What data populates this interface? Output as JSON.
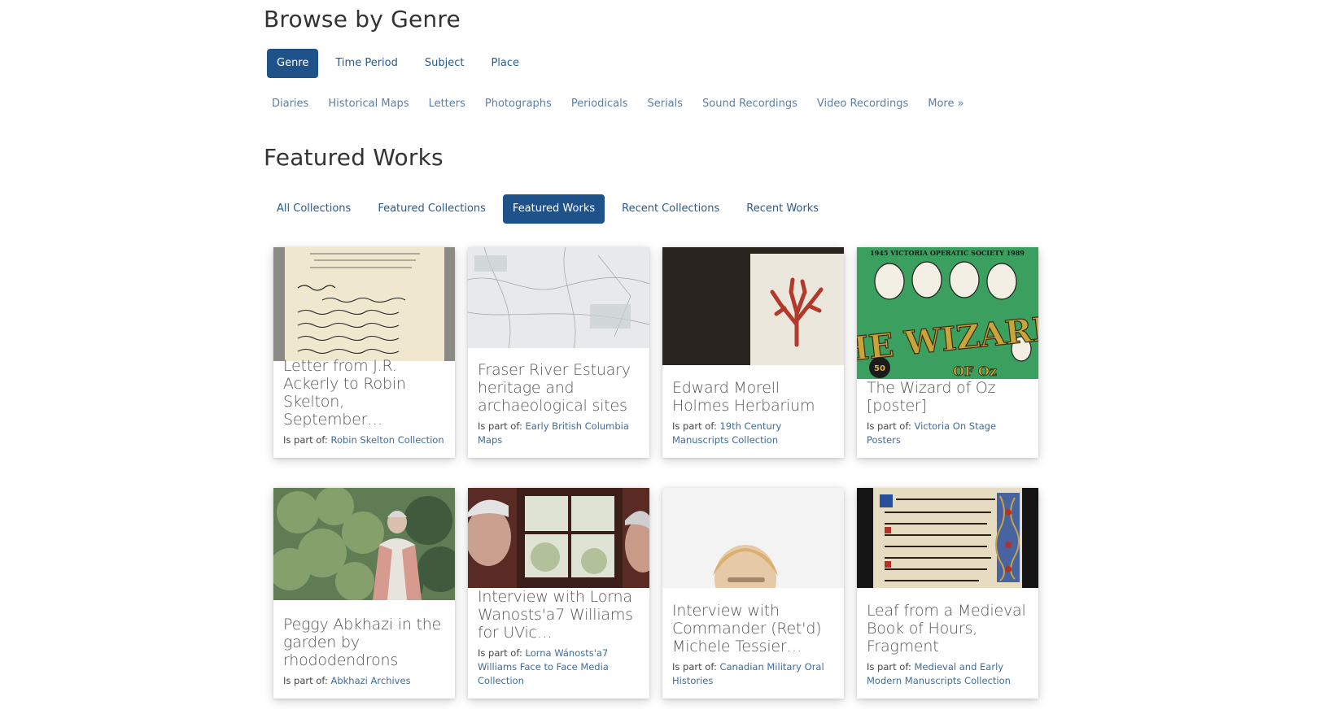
{
  "browse": {
    "title": "Browse by Genre",
    "tabs": [
      "Genre",
      "Time Period",
      "Subject",
      "Place"
    ],
    "active_tab": "Genre",
    "genre_links": [
      "Diaries",
      "Historical Maps",
      "Letters",
      "Photographs",
      "Periodicals",
      "Serials",
      "Sound Recordings",
      "Video Recordings",
      "More »"
    ]
  },
  "featured": {
    "title": "Featured Works",
    "tabs": [
      "All Collections",
      "Featured Collections",
      "Featured Works",
      "Recent Collections",
      "Recent Works"
    ],
    "active_tab": "Featured Works",
    "part_of_label": "Is part of:",
    "cards": [
      {
        "title": "Letter from J.R. Ackerly to Robin Skelton, September…",
        "collection": "Robin Skelton Collection"
      },
      {
        "title": "Fraser River Estuary heritage and archaeological sites",
        "collection": "Early British Columbia Maps"
      },
      {
        "title": "Edward Morell Holmes Herbarium",
        "collection": "19th Century Manuscripts Collection"
      },
      {
        "title": "The Wizard of Oz [poster]",
        "collection": "Victoria On Stage Posters"
      },
      {
        "title": "Peggy Abkhazi in the garden by rhododendrons",
        "collection": "Abkhazi Archives"
      },
      {
        "title": "Interview with Lorna Wanosts'a7 Williams for UVic…",
        "collection": "Lorna Wánosts'a7 Williams Face to Face Media Collection"
      },
      {
        "title": "Interview with Commander (Ret'd) Michele Tessier…",
        "collection": "Canadian Military Oral Histories"
      },
      {
        "title": "Leaf from a Medieval Book of Hours, Fragment",
        "collection": "Medieval and Early Modern Manuscripts Collection"
      }
    ]
  },
  "thumb_texts": {
    "poster_header": "1945   VICTORIA OPERATIC SOCIETY   1989",
    "poster_wizard": "THE WIZARD",
    "poster_of": "OF Oz",
    "poster_badge": "50"
  },
  "colors": {
    "accent": "#1f5289",
    "link": "#3f6c9b"
  }
}
